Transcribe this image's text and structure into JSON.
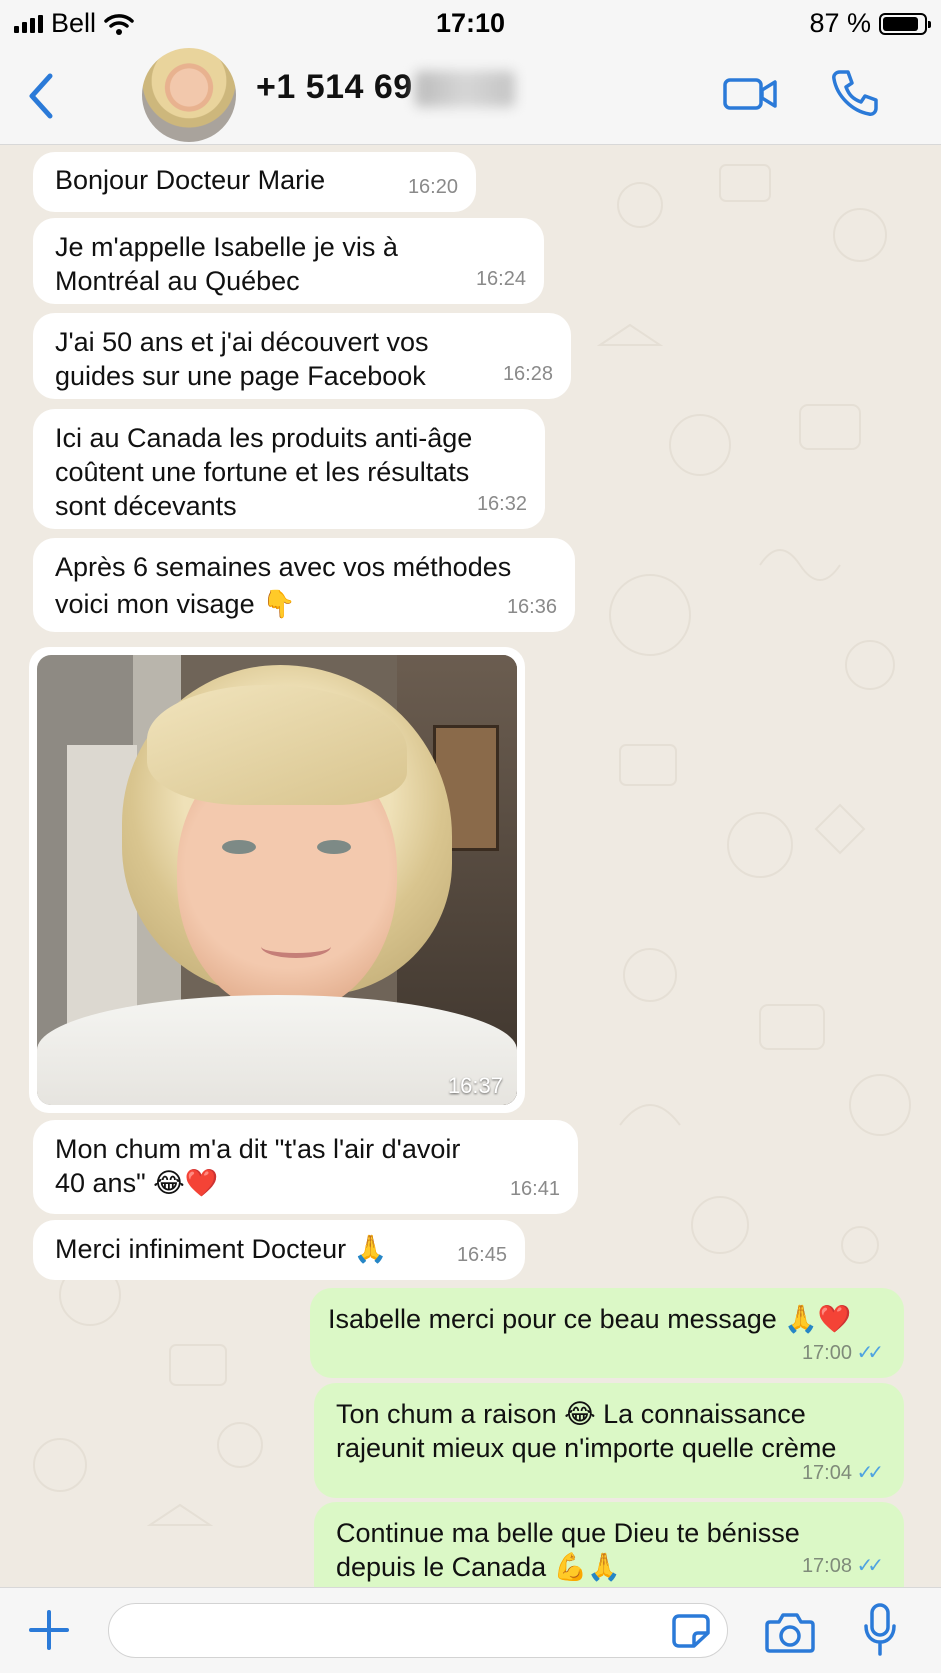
{
  "status_bar": {
    "carrier": "Bell",
    "time": "17:10",
    "battery": "87 %",
    "battery_level": 0.87
  },
  "header": {
    "contact_name": "+1 514 69"
  },
  "messages_in": [
    {
      "text": "Bonjour Docteur Marie",
      "time": "16:20"
    },
    {
      "text": "Je m'appelle Isabelle je vis à\nMontréal au Québec",
      "time": "16:24"
    },
    {
      "text": "J'ai 50 ans et j'ai découvert vos\nguides sur une page Facebook",
      "time": "16:28"
    },
    {
      "text": "Ici au Canada les produits anti-âge\ncoûtent une fortune et les résultats\nsont décevants",
      "time": "16:32"
    },
    {
      "text": "Après 6 semaines avec vos méthodes\nvoici mon visage 👇",
      "time": "16:36"
    },
    {
      "text": "Mon chum m'a dit \"t'as l'air d'avoir\n40 ans\" 😂❤️",
      "time": "16:41"
    },
    {
      "text": "Merci infiniment Docteur 🙏",
      "time": "16:45"
    }
  ],
  "photo": {
    "time": "16:37"
  },
  "messages_out": [
    {
      "text": "Isabelle merci pour ce beau message 🙏❤️",
      "time": "17:00"
    },
    {
      "text": "Ton chum a raison 😂 La connaissance\nrajeunit mieux que n'importe quelle crème",
      "time": "17:04"
    },
    {
      "text": "Continue ma belle que Dieu te bénisse\ndepuis le Canada 💪🙏",
      "time": "17:08"
    }
  ],
  "colors": {
    "accent": "#2b7ad8",
    "chat_bg": "#efeae2",
    "incoming": "#ffffff",
    "outgoing": "#dbf8c6",
    "read_tick": "#4fa3e0"
  },
  "icons": [
    "back-chevron-icon",
    "video-call-icon",
    "phone-icon",
    "plus-icon",
    "sticker-icon",
    "camera-icon",
    "microphone-icon",
    "read-receipt-icon"
  ]
}
